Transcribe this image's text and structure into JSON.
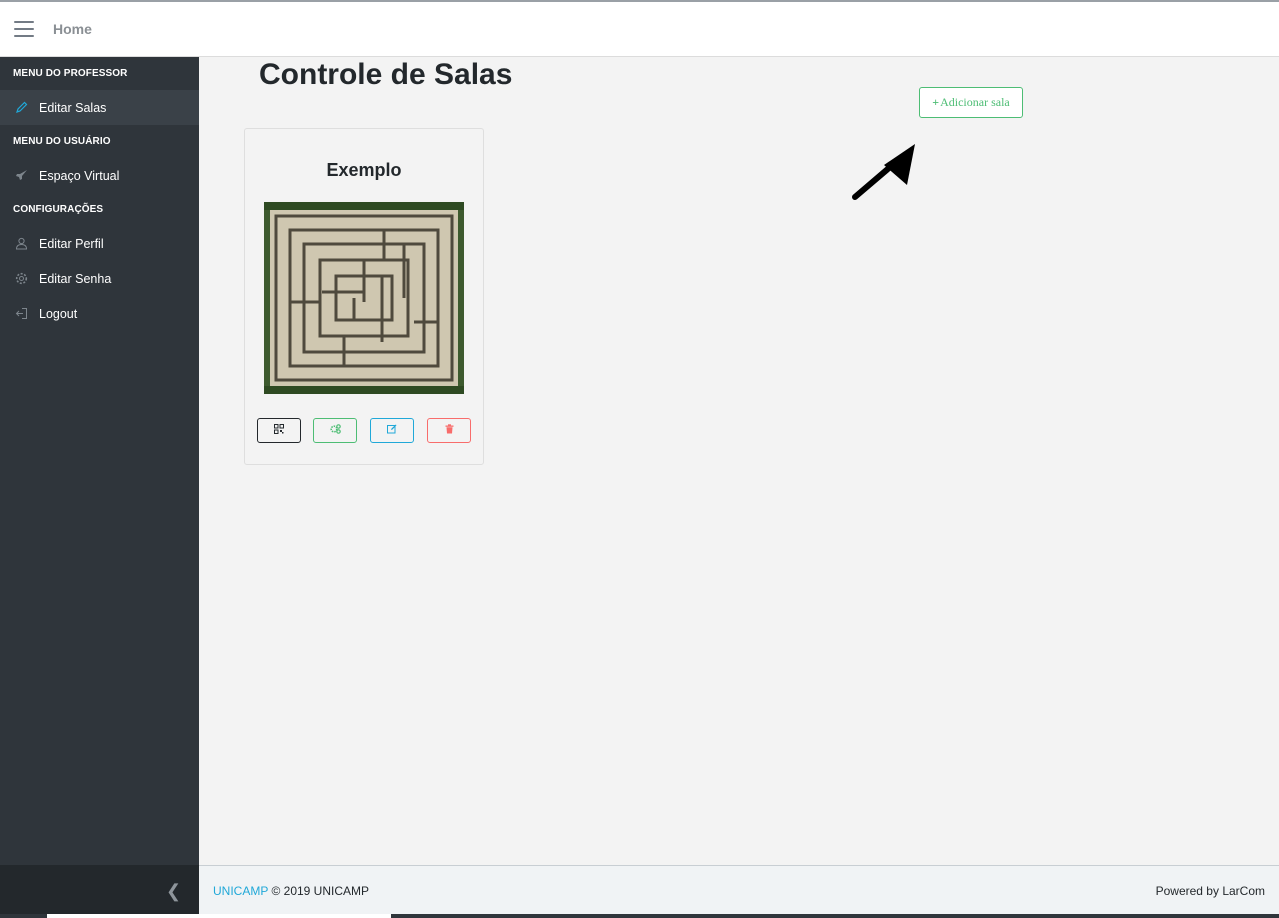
{
  "topbar": {
    "home_label": "Home"
  },
  "sidebar": {
    "sections": [
      {
        "header": "MENU DO PROFESSOR",
        "items": [
          {
            "label": "Editar Salas",
            "icon": "pencil-icon",
            "active": true
          }
        ]
      },
      {
        "header": "MENU DO USUÁRIO",
        "items": [
          {
            "label": "Espaço Virtual",
            "icon": "rocket-icon",
            "active": false
          }
        ]
      },
      {
        "header": "CONFIGURAÇÕES",
        "items": [
          {
            "label": "Editar Perfil",
            "icon": "user-icon",
            "active": false
          },
          {
            "label": "Editar Senha",
            "icon": "gear-icon",
            "active": false
          },
          {
            "label": "Logout",
            "icon": "logout-icon",
            "active": false
          }
        ]
      }
    ]
  },
  "main": {
    "title": "Controle de Salas",
    "add_button_label": "Adicionar sala",
    "card": {
      "title": "Exemplo",
      "image_icon": "maze-image",
      "buttons": [
        "qr-code-icon",
        "gears-icon",
        "edit-icon",
        "trash-icon"
      ]
    }
  },
  "footer": {
    "link": "UNICAMP",
    "copyright": "© 2019 UNICAMP",
    "powered": "Powered by LarCom"
  },
  "colors": {
    "primary": "#20a8d8",
    "success": "#4dbd74",
    "danger": "#f86c6b",
    "sidebar_bg": "#2f353b",
    "dark": "#23282c"
  }
}
